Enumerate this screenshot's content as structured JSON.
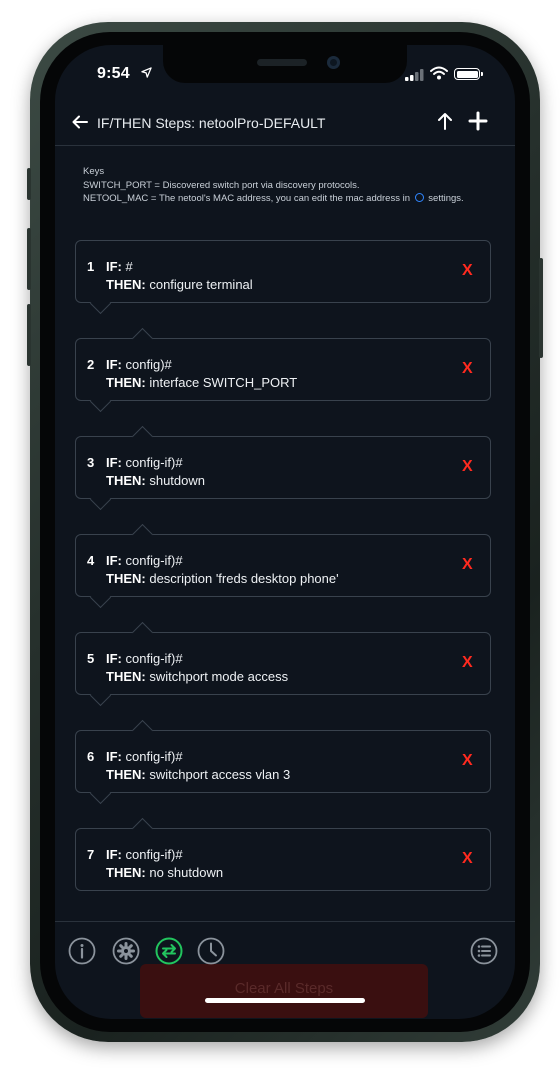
{
  "status_bar": {
    "time": "9:54"
  },
  "header": {
    "title": "IF/THEN Steps: netoolPro-DEFAULT"
  },
  "keys": {
    "title": "Keys",
    "line1": "SWITCH_PORT = Discovered switch port via discovery protocols.",
    "line2_prefix": "NETOOL_MAC = The netool's MAC address, you can edit the mac address in",
    "line2_suffix": "settings."
  },
  "labels": {
    "if": "IF:",
    "then": "THEN:",
    "delete": "X"
  },
  "steps": [
    {
      "num": "1",
      "if_value": "#",
      "then_value": "configure terminal"
    },
    {
      "num": "2",
      "if_value": "config)#",
      "then_value": "interface SWITCH_PORT"
    },
    {
      "num": "3",
      "if_value": "config-if)#",
      "then_value": "shutdown"
    },
    {
      "num": "4",
      "if_value": "config-if)#",
      "then_value": "description 'freds desktop phone'"
    },
    {
      "num": "5",
      "if_value": "config-if)#",
      "then_value": "switchport mode access"
    },
    {
      "num": "6",
      "if_value": "config-if)#",
      "then_value": "switchport access vlan 3"
    },
    {
      "num": "7",
      "if_value": "config-if)#",
      "then_value": "no shutdown"
    }
  ],
  "bottom_bar": {
    "icons": [
      "info-icon",
      "gear-icon",
      "swap-icon",
      "clock-icon",
      "list-icon"
    ],
    "active_icon": "swap-icon",
    "clear_label": "Clear All Steps"
  },
  "colors": {
    "accent_green": "#22c55e",
    "delete_red": "#ff2a1f",
    "background": "#0e141d"
  }
}
